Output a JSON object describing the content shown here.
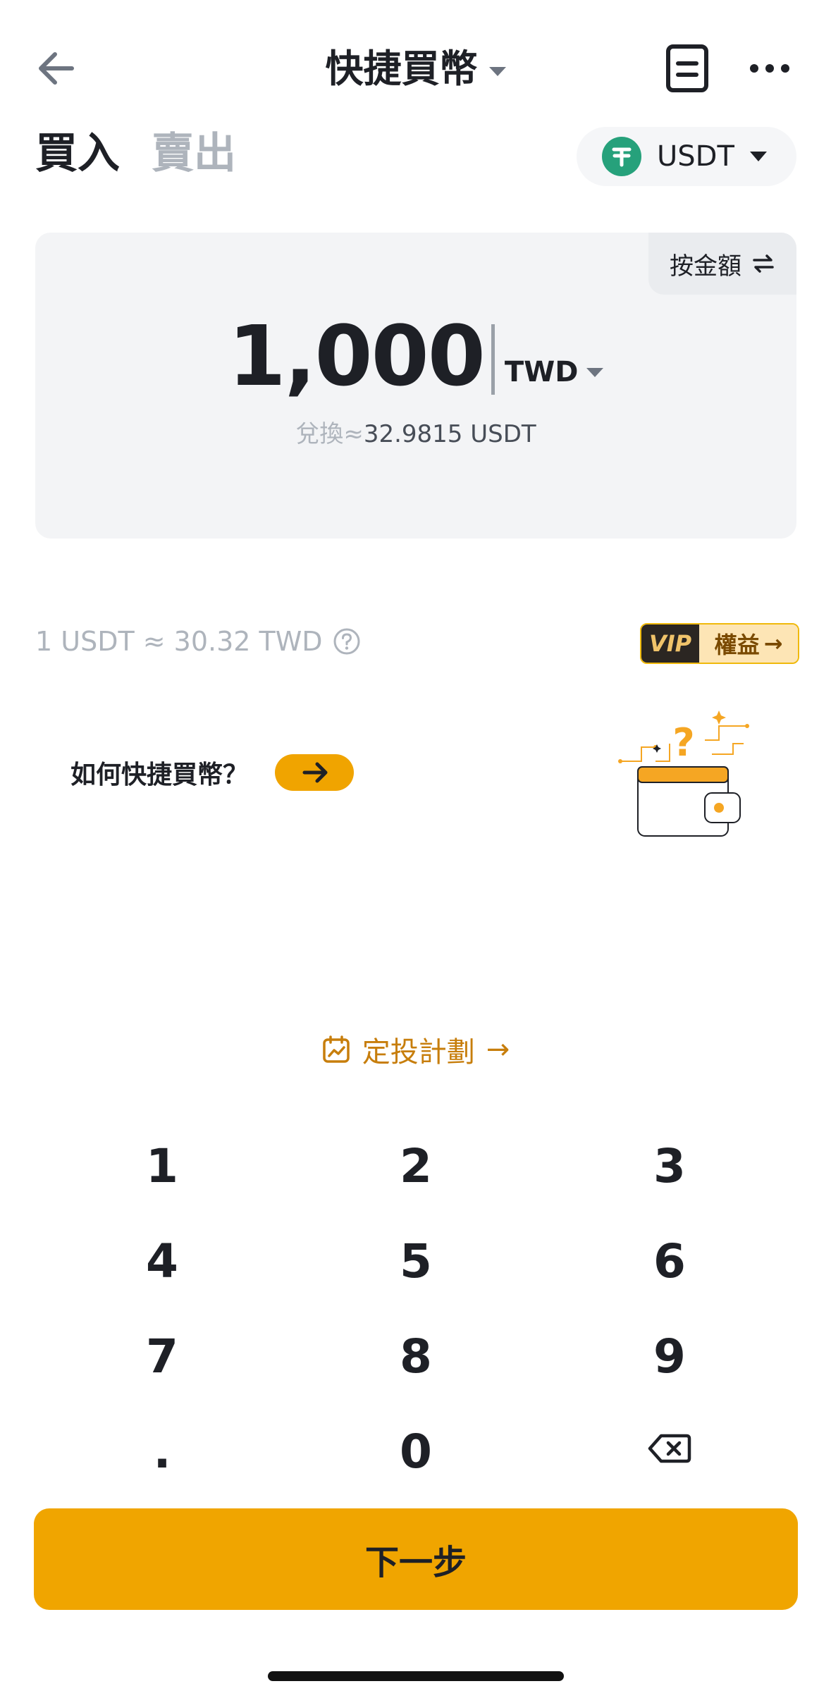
{
  "header": {
    "title": "快捷買幣",
    "back_icon": "arrow-left-icon",
    "order_icon": "order-list-icon",
    "more_icon": "more-dots-icon"
  },
  "tabs": [
    {
      "label": "買入",
      "active": true
    },
    {
      "label": "賣出",
      "active": false
    }
  ],
  "coin_select": {
    "symbol": "USDT",
    "icon": "tether-icon",
    "color": "#26a17b"
  },
  "amount_card": {
    "toggle_label": "按金額",
    "toggle_icon": "swap-icon",
    "amount": "1,000",
    "currency": "TWD",
    "convert_label": "兌換≈",
    "convert_value": "32.9815 USDT"
  },
  "rate": {
    "text": "1 USDT ≈ 30.32 TWD",
    "help_icon": "question-circle-icon"
  },
  "vip_badge": {
    "vip": "VIP",
    "label": "權益",
    "arrow": "→"
  },
  "howto": {
    "label": "如何快捷買幣？",
    "arrow_icon": "arrow-right-icon",
    "illustration": "wallet-question-illustration"
  },
  "dca": {
    "label": "定投計劃",
    "icon": "calendar-chart-icon",
    "arrow": "→"
  },
  "keypad": {
    "keys": [
      "1",
      "2",
      "3",
      "4",
      "5",
      "6",
      "7",
      "8",
      "9",
      ".",
      "0"
    ],
    "backspace_icon": "backspace-icon"
  },
  "next_button": {
    "label": "下一步"
  },
  "colors": {
    "accent": "#f0a500",
    "link": "#c77e0c",
    "muted": "#aeb4bc",
    "text": "#1e2026"
  }
}
